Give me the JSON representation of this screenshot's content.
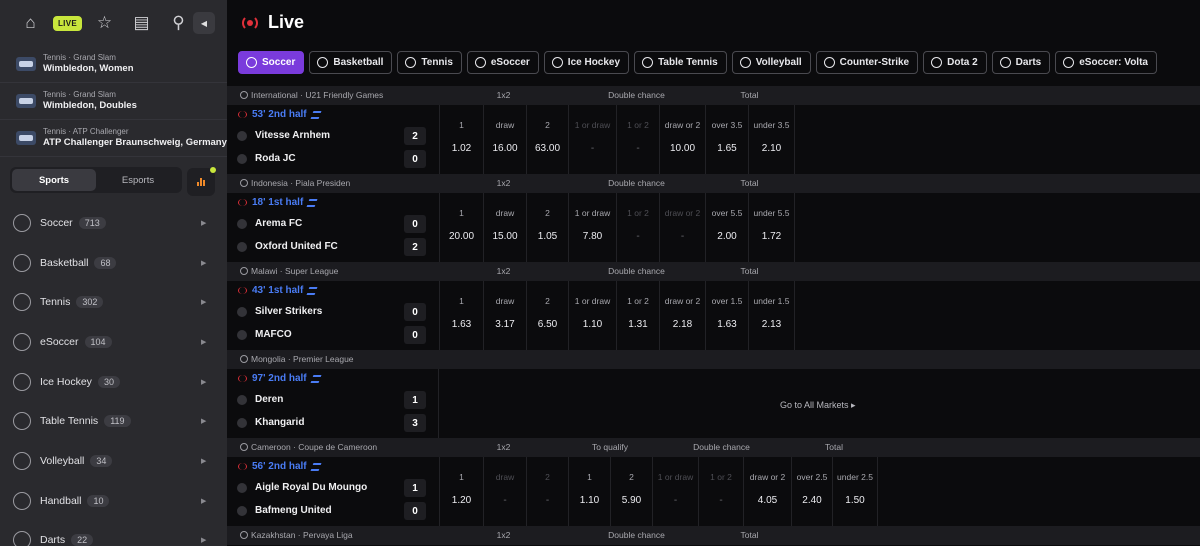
{
  "sidebar": {
    "icons": [
      "home-icon",
      "live-icon",
      "star-icon",
      "betslip-icon",
      "search-icon"
    ],
    "live_badge": "LIVE",
    "favorites": [
      {
        "sub": "Tennis · Grand Slam",
        "title": "Wimbledon, Women"
      },
      {
        "sub": "Tennis · Grand Slam",
        "title": "Wimbledon, Doubles"
      },
      {
        "sub": "Tennis · ATP Challenger",
        "title": "ATP Challenger Braunschweig, Germany"
      }
    ],
    "tabs": {
      "sports": "Sports",
      "esports": "Esports"
    },
    "sports": [
      {
        "label": "Soccer",
        "count": "713"
      },
      {
        "label": "Basketball",
        "count": "68"
      },
      {
        "label": "Tennis",
        "count": "302"
      },
      {
        "label": "eSoccer",
        "count": "104"
      },
      {
        "label": "Ice Hockey",
        "count": "30"
      },
      {
        "label": "Table Tennis",
        "count": "119"
      },
      {
        "label": "Volleyball",
        "count": "34"
      },
      {
        "label": "Handball",
        "count": "10"
      },
      {
        "label": "Darts",
        "count": "22"
      }
    ]
  },
  "main": {
    "title": "Live",
    "sport_tabs": [
      "Soccer",
      "Basketball",
      "Tennis",
      "eSoccer",
      "Ice Hockey",
      "Table Tennis",
      "Volleyball",
      "Counter-Strike",
      "Dota 2",
      "Darts",
      "eSoccer: Volta"
    ],
    "goto_all": "Go to All Markets ▸",
    "events": [
      {
        "league": "International · U21 Friendly Games",
        "markets": [
          "1x2",
          "Double chance",
          "Total"
        ],
        "time": "53' 2nd half",
        "home": "Vitesse Arnhem",
        "home_score": "2",
        "away": "Roda JC",
        "away_score": "0",
        "odds": [
          {
            "l": "1",
            "v": "1.02"
          },
          {
            "l": "draw",
            "v": "16.00"
          },
          {
            "l": "2",
            "v": "63.00"
          },
          {
            "l": "1 or draw",
            "v": "-"
          },
          {
            "l": "1 or 2",
            "v": "-"
          },
          {
            "l": "draw or 2",
            "v": "10.00"
          },
          {
            "l": "over 3.5",
            "v": "1.65"
          },
          {
            "l": "under 3.5",
            "v": "2.10"
          }
        ]
      },
      {
        "league": "Indonesia · Piala Presiden",
        "markets": [
          "1x2",
          "Double chance",
          "Total"
        ],
        "time": "18' 1st half",
        "home": "Arema FC",
        "home_score": "0",
        "away": "Oxford United FC",
        "away_score": "2",
        "odds": [
          {
            "l": "1",
            "v": "20.00"
          },
          {
            "l": "draw",
            "v": "15.00"
          },
          {
            "l": "2",
            "v": "1.05"
          },
          {
            "l": "1 or draw",
            "v": "7.80"
          },
          {
            "l": "1 or 2",
            "v": "-"
          },
          {
            "l": "draw or 2",
            "v": "-"
          },
          {
            "l": "over 5.5",
            "v": "2.00"
          },
          {
            "l": "under 5.5",
            "v": "1.72"
          }
        ]
      },
      {
        "league": "Malawi · Super League",
        "markets": [
          "1x2",
          "Double chance",
          "Total"
        ],
        "time": "43' 1st half",
        "home": "Silver Strikers",
        "home_score": "0",
        "away": "MAFCO",
        "away_score": "0",
        "odds": [
          {
            "l": "1",
            "v": "1.63"
          },
          {
            "l": "draw",
            "v": "3.17"
          },
          {
            "l": "2",
            "v": "6.50"
          },
          {
            "l": "1 or draw",
            "v": "1.10"
          },
          {
            "l": "1 or 2",
            "v": "1.31"
          },
          {
            "l": "draw or 2",
            "v": "2.18"
          },
          {
            "l": "over 1.5",
            "v": "1.63"
          },
          {
            "l": "under 1.5",
            "v": "2.13"
          }
        ]
      },
      {
        "league": "Mongolia · Premier League",
        "time": "97' 2nd half",
        "home": "Deren",
        "home_score": "1",
        "away": "Khangarid",
        "away_score": "3"
      },
      {
        "league": "Cameroon · Coupe de Cameroon",
        "markets": [
          "1x2",
          "To qualify",
          "Double chance",
          "Total"
        ],
        "time": "56' 2nd half",
        "home": "Aigle Royal Du Moungo",
        "home_score": "1",
        "away": "Bafmeng United",
        "away_score": "0",
        "odds": [
          {
            "l": "1",
            "v": "1.20"
          },
          {
            "l": "draw",
            "v": "-"
          },
          {
            "l": "2",
            "v": "-"
          },
          {
            "l": "1",
            "v": "1.10"
          },
          {
            "l": "2",
            "v": "5.90"
          },
          {
            "l": "1 or draw",
            "v": "-"
          },
          {
            "l": "1 or 2",
            "v": "-"
          },
          {
            "l": "draw or 2",
            "v": "4.05"
          },
          {
            "l": "over 2.5",
            "v": "2.40"
          },
          {
            "l": "under 2.5",
            "v": "1.50"
          }
        ]
      },
      {
        "league": "Kazakhstan · Pervaya Liga",
        "markets": [
          "1x2",
          "Double chance",
          "Total"
        ]
      }
    ]
  },
  "colors": {
    "accent": "#7a3bdc",
    "live_red": "#e0303a",
    "time_blue": "#4a7cf4",
    "lime": "#c8e63c"
  }
}
